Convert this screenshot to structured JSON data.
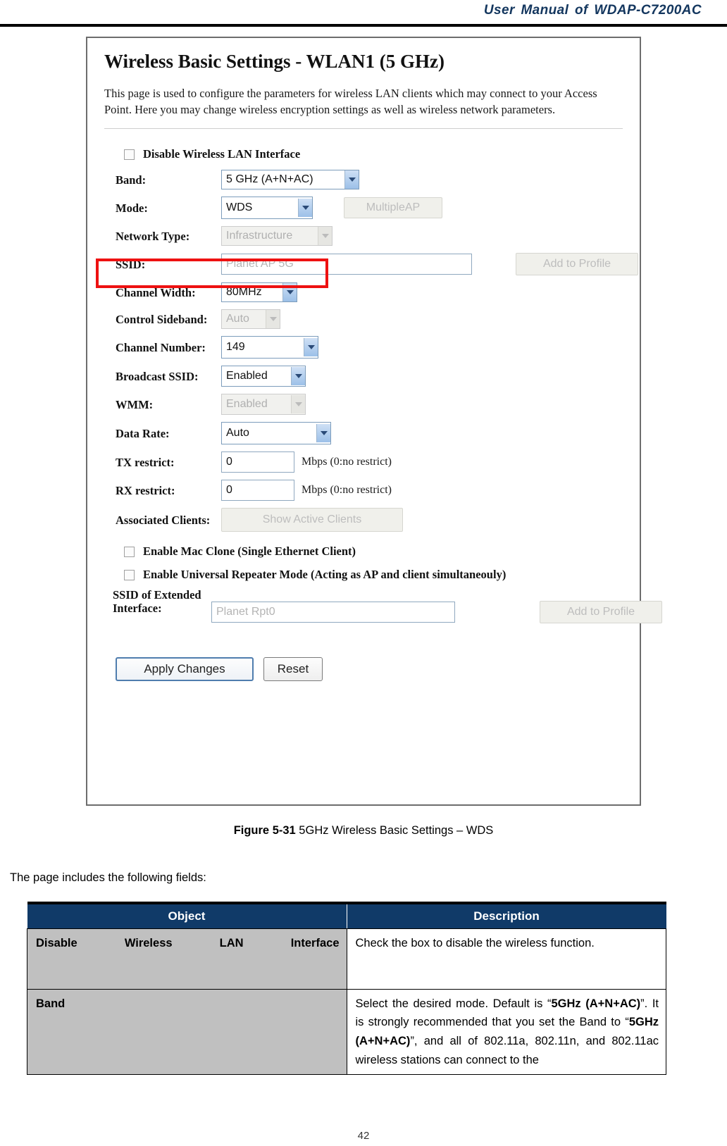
{
  "header": {
    "manual_title": "User Manual of WDAP-C7200AC"
  },
  "screenshot": {
    "title": "Wireless Basic Settings - WLAN1 (5 GHz)",
    "description": "This page is used to configure the parameters for wireless LAN clients which may connect to your Access Point. Here you may change wireless encryption settings as well as wireless network parameters.",
    "disable_wlan_checkbox_label": "Disable Wireless LAN Interface",
    "fields": {
      "band_label": "Band:",
      "band_value": "5 GHz (A+N+AC)",
      "mode_label": "Mode:",
      "mode_value": "WDS",
      "multiple_ap_button": "MultipleAP",
      "network_type_label": "Network Type:",
      "network_type_value": "Infrastructure",
      "ssid_label": "SSID:",
      "ssid_value": "Planet AP 5G",
      "add_to_profile_button": "Add to Profile",
      "channel_width_label": "Channel Width:",
      "channel_width_value": "80MHz",
      "control_sideband_label": "Control Sideband:",
      "control_sideband_value": "Auto",
      "channel_number_label": "Channel Number:",
      "channel_number_value": "149",
      "broadcast_ssid_label": "Broadcast SSID:",
      "broadcast_ssid_value": "Enabled",
      "wmm_label": "WMM:",
      "wmm_value": "Enabled",
      "data_rate_label": "Data Rate:",
      "data_rate_value": "Auto",
      "tx_restrict_label": "TX restrict:",
      "tx_restrict_value": "0",
      "tx_restrict_note": "Mbps (0:no restrict)",
      "rx_restrict_label": "RX restrict:",
      "rx_restrict_value": "0",
      "rx_restrict_note": "Mbps (0:no restrict)",
      "associated_clients_label": "Associated Clients:",
      "show_active_clients_button": "Show Active Clients",
      "mac_clone_checkbox_label": "Enable Mac Clone (Single Ethernet Client)",
      "universal_repeater_checkbox_label": "Enable Universal Repeater Mode (Acting as AP and client simultaneouly)",
      "ssid_extended_label": "SSID of Extended Interface:",
      "ssid_extended_value": "Planet Rpt0",
      "add_to_profile_button_2": "Add to Profile"
    },
    "actions": {
      "apply": "Apply Changes",
      "reset": "Reset"
    },
    "highlight_color": "#ee1111"
  },
  "caption": {
    "figure_number": "Figure 5-31",
    "figure_text": " 5GHz Wireless Basic Settings – WDS"
  },
  "intro_text": "The page includes the following fields:",
  "table": {
    "headers": [
      "Object",
      "Description"
    ],
    "rows": [
      {
        "object": "Disable Wireless LAN Interface",
        "description_html": "Check the box to disable the wireless function."
      },
      {
        "object": "Band",
        "description_html": "Select the desired mode. Default is “<b>5GHz (A+N+AC)</b>”. It is strongly recommended that you set the Band to “<b>5GHz (A+N+AC)</b>”, and all of 802.11a, 802.11n, and 802.11ac wireless stations can connect to the"
      }
    ],
    "header_bg": "#103a68",
    "object_cell_bg": "#c0c0c0"
  },
  "footer": {
    "page_number": "42"
  }
}
